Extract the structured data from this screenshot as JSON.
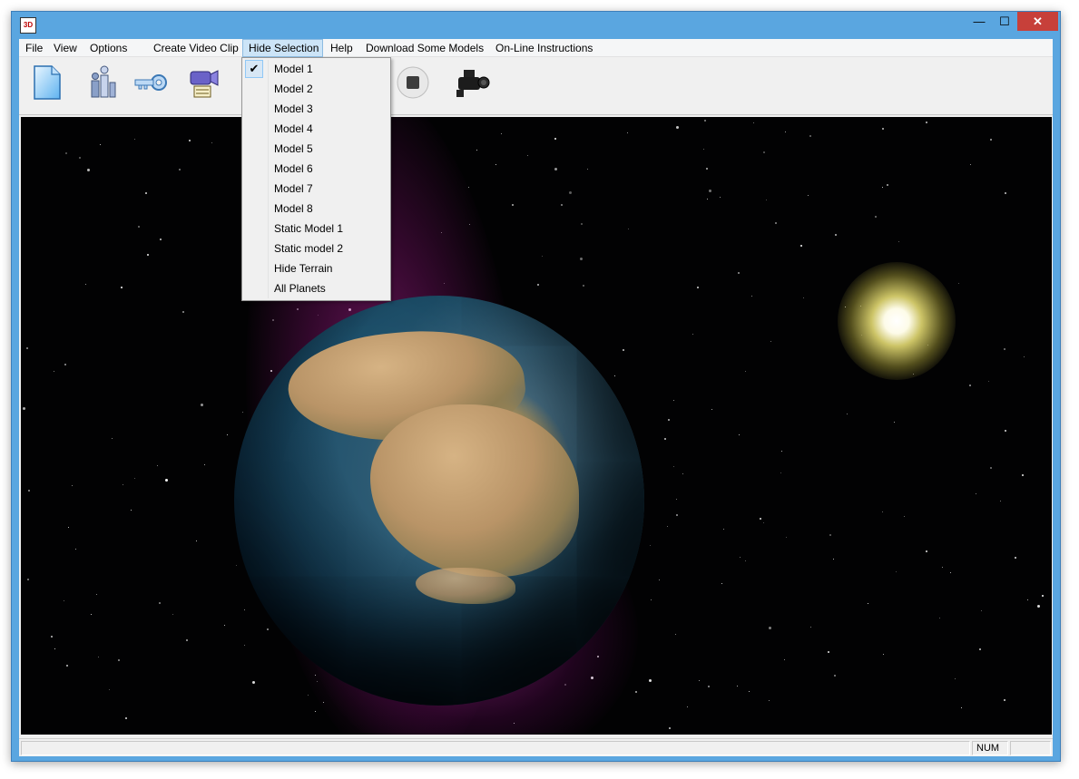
{
  "window": {
    "icon": "3-D model-viewer-icon",
    "icon_text": "3D"
  },
  "window_controls": {
    "minimize": "—",
    "maximize": "☐",
    "close": "✕"
  },
  "menubar": {
    "items": [
      "File",
      "View",
      "Options",
      "Create Video Clip",
      "Hide Selection",
      "Help",
      "Download Some Models",
      "On-Line Instructions"
    ]
  },
  "toolbar": {
    "buttons": [
      "new-document-icon",
      "model-figures-icon",
      "key-icon",
      "video-clip-icon",
      "stop-icon",
      "video-camera-icon"
    ]
  },
  "hide_selection_menu": {
    "items": [
      {
        "label": "Model 1",
        "checked": true
      },
      {
        "label": "Model 2",
        "checked": false
      },
      {
        "label": "Model 3",
        "checked": false
      },
      {
        "label": "Model 4",
        "checked": false
      },
      {
        "label": "Model 5",
        "checked": false
      },
      {
        "label": "Model 6",
        "checked": false
      },
      {
        "label": "Model 7",
        "checked": false
      },
      {
        "label": "Model 8",
        "checked": false
      },
      {
        "label": "Static Model 1",
        "checked": false
      },
      {
        "label": "Static model 2",
        "checked": false
      },
      {
        "label": "Hide Terrain",
        "checked": false
      },
      {
        "label": "All Planets",
        "checked": false
      }
    ],
    "check_glyph": "✔"
  },
  "scene": {
    "planet": "earth",
    "light": "sun",
    "background": "starfield-with-nebula"
  },
  "statusbar": {
    "panes": [
      "",
      "NUM",
      ""
    ]
  },
  "colors": {
    "title_bar": "#5aa6e0",
    "close_button": "#c7403a",
    "menu_highlight": "#cce4f7",
    "space": "#020203"
  }
}
